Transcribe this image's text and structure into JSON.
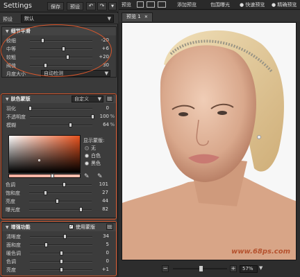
{
  "left_toolbar": {
    "title": "Settings",
    "save_label": "保存",
    "preset_label": "预设",
    "undo_icon": "undo-icon",
    "redo_icon": "redo-icon",
    "menu_icon": "menu-icon"
  },
  "preset_row": {
    "label": "预设",
    "value": "默认"
  },
  "detail_smoothing": {
    "title": "细节平滑",
    "sliders": [
      {
        "label": "较细",
        "value": "-20",
        "level": 0.2
      },
      {
        "label": "中等",
        "value": "+6",
        "level": 0.53
      },
      {
        "label": "较粗",
        "value": "+20",
        "level": 0.6
      },
      {
        "label": "阀值",
        "value": "30",
        "level": 0.24
      }
    ],
    "threshold_label": "月度大小",
    "threshold_value": "自动检测"
  },
  "skin_mask": {
    "title": "肤色蒙版",
    "mode_value": "自定义",
    "sliders": [
      {
        "label": "羽化",
        "value": "0",
        "unit": "",
        "level": 0.0
      },
      {
        "label": "不透明度",
        "value": "100",
        "unit": "%",
        "level": 1.0
      },
      {
        "label": "模糊",
        "value": "64",
        "unit": "%",
        "level": 0.64
      }
    ],
    "display_mask_label": "显示蒙版:",
    "radio_options": [
      {
        "label": "无",
        "selected": true
      },
      {
        "label": "白色",
        "selected": false
      },
      {
        "label": "黑色",
        "selected": false
      }
    ],
    "picker_sliders": [
      {
        "label": "色调",
        "value": "101",
        "level": 0.55
      },
      {
        "label": "饱和度",
        "value": "27",
        "level": 0.25
      },
      {
        "label": "亮度",
        "value": "44",
        "level": 0.44
      },
      {
        "label": "曝光度",
        "value": "82",
        "level": 0.82
      }
    ]
  },
  "enhance": {
    "title": "增强功能",
    "checkbox_label": "使用蒙版",
    "checked": true,
    "sliders": [
      {
        "label": "清晰度",
        "value": "34",
        "level": 0.55
      },
      {
        "label": "面和度",
        "value": "5",
        "level": 0.25
      },
      {
        "label": "暖色调",
        "value": "0",
        "level": 0.5
      },
      {
        "label": "色调",
        "value": "0",
        "level": 0.5
      },
      {
        "label": "亮度",
        "value": "+1",
        "level": 0.5
      }
    ]
  },
  "right_toolbar": {
    "preview_label": "预览",
    "add_preview_label": "添加预览",
    "bracket_label": "包围曝光",
    "fast_preview_label": "快速预览",
    "sharp_preview_label": "精确预览"
  },
  "tab": {
    "label": "预览 1"
  },
  "zoom": {
    "value": "57%"
  },
  "watermark": {
    "text": "www.68ps.com"
  },
  "colors": {
    "accent": "#d9572c",
    "panel": "#3a3a3a",
    "canvas_bg": "#f6f6f6"
  }
}
